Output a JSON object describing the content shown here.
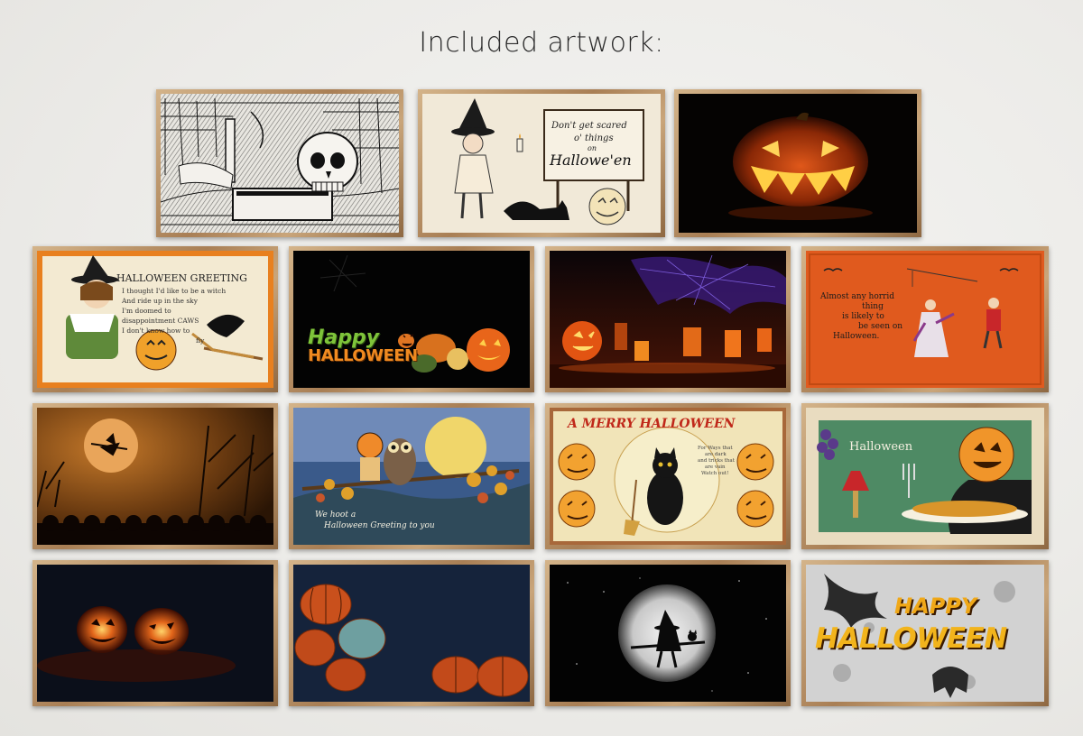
{
  "heading": "Included artwork:",
  "artworks": [
    {
      "title": "Vintage skull and books engraving"
    },
    {
      "title": "Don't get scared Halloween postcard",
      "text_lines": [
        "Don't get scared",
        "o' things",
        "on",
        "Hallowe'en"
      ]
    },
    {
      "title": "Glowing jack-o'-lantern"
    },
    {
      "title": "Halloween Greeting postcard",
      "heading": "HALLOWEEN GREETING",
      "text_lines": [
        "I thought I'd like to be a witch",
        "And ride up in the sky",
        "I'm doomed to",
        "disappointment CAWS",
        "I don't know how to",
        "fly"
      ]
    },
    {
      "title": "Happy Halloween pumpkins",
      "line1": "Happy",
      "line2": "HALLOWEEN"
    },
    {
      "title": "Candles and spider webs"
    },
    {
      "title": "Almost any horrid thing postcard",
      "text_lines": [
        "Almost any horrid",
        "thing",
        "is likely to",
        "be seen on",
        "Halloween."
      ]
    },
    {
      "title": "Witch over the moon"
    },
    {
      "title": "Owl greeting postcard",
      "text_lines": [
        "We hoot a",
        "Halloween Greeting to you"
      ]
    },
    {
      "title": "A Merry Halloween black cat",
      "heading": "A MERRY HALLOWEEN",
      "small_lines": [
        "For Ways that",
        "are dark",
        "and tricks that",
        "are vain",
        "Watch out!"
      ]
    },
    {
      "title": "Pumpkin head dinner postcard",
      "heading": "Halloween"
    },
    {
      "title": "Two carved pumpkins"
    },
    {
      "title": "Pumpkins on dark blue"
    },
    {
      "title": "Witch silhouette full moon"
    },
    {
      "title": "Happy Halloween bats",
      "line1": "HAPPY",
      "line2": "HALLOWEEN"
    }
  ]
}
